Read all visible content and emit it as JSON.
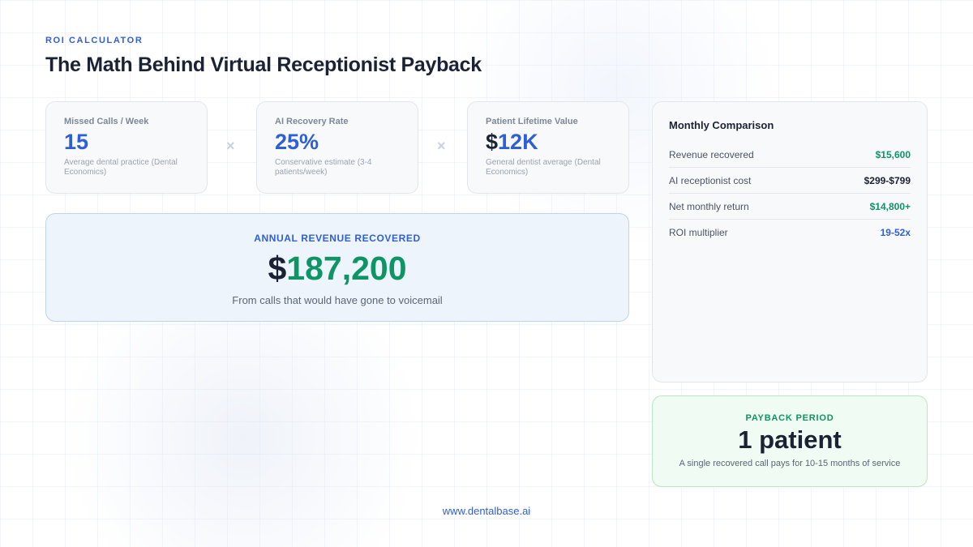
{
  "header": {
    "eyebrow": "ROI CALCULATOR",
    "title": "The Math Behind Virtual Receptionist Payback"
  },
  "metrics": [
    {
      "label": "Missed Calls / Week",
      "value": "15",
      "note": "Average dental practice (Dental Economics)"
    },
    {
      "label": "AI Recovery Rate",
      "value": "25%",
      "note": "Conservative estimate (3-4 patients/week)"
    },
    {
      "label": "Patient Lifetime Value",
      "value_prefix": "$",
      "value": "12K",
      "note": "General dentist average (Dental Economics)"
    }
  ],
  "operator": "×",
  "annual": {
    "label": "ANNUAL REVENUE RECOVERED",
    "value_prefix": "$",
    "value": "187,200",
    "note": "From calls that would have gone to voicemail"
  },
  "comparison": {
    "title": "Monthly Comparison",
    "rows": [
      {
        "label": "Revenue recovered",
        "value": "$15,600",
        "color": "#0e9565"
      },
      {
        "label": "AI receptionist cost",
        "value": "$299-$799",
        "color": "#1a2233"
      },
      {
        "label": "Net monthly return",
        "value": "$14,800+",
        "color": "#0e9565"
      },
      {
        "label": "ROI multiplier",
        "value": "19-52x",
        "color": "#2f5fd6"
      }
    ]
  },
  "payback": {
    "label": "PAYBACK PERIOD",
    "value": "1 patient",
    "note": "A single recovered call pays for 10-15 months of service"
  },
  "footer": {
    "link": "www.dentalbase.ai"
  },
  "colors": {
    "accent_blue": "#2f5fd6",
    "accent_green": "#0e9565",
    "text_dark": "#1a2233"
  }
}
